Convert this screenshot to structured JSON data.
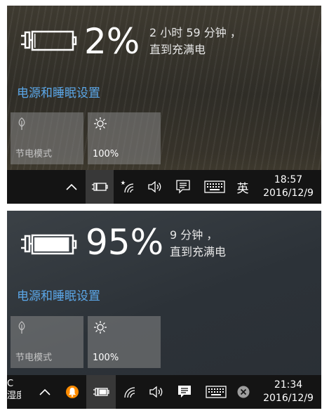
{
  "panel1": {
    "battery_percent": "2%",
    "battery_level": 0.02,
    "time_line1": "2 小时 59 分钟 ，",
    "time_line2": "直到充满电",
    "power_settings_link": "电源和睡眠设置",
    "battery_saver_label": "节电模式",
    "brightness_label": "100%",
    "taskbar": {
      "ime": "英",
      "clock_time": "18:57",
      "clock_date": "2016/12/9",
      "icons": [
        "chevron-up-icon",
        "battery-icon",
        "wifi-icon",
        "volume-icon",
        "action-center-icon",
        "keyboard-icon"
      ]
    }
  },
  "panel2": {
    "battery_percent": "95%",
    "battery_level": 0.95,
    "time_line1": "9 分钟 ，",
    "time_line2": "直到充满电",
    "power_settings_link": "电源和睡眠设置",
    "battery_saver_label": "节电模式",
    "brightness_label": "100%",
    "taskbar": {
      "edge_text_line1": "C",
      "edge_text_line2": "湿度",
      "clock_time": "21:34",
      "clock_date": "2016/12/9",
      "icons": [
        "chevron-up-icon",
        "notification-app-icon",
        "battery-icon",
        "wifi-icon",
        "volume-icon",
        "action-center-icon",
        "keyboard-icon",
        "close-circle-icon"
      ]
    }
  },
  "colors": {
    "link": "#5ba7e8",
    "tile": "#878787",
    "taskbar": "#141414",
    "orange_app": "#ff8c00"
  }
}
